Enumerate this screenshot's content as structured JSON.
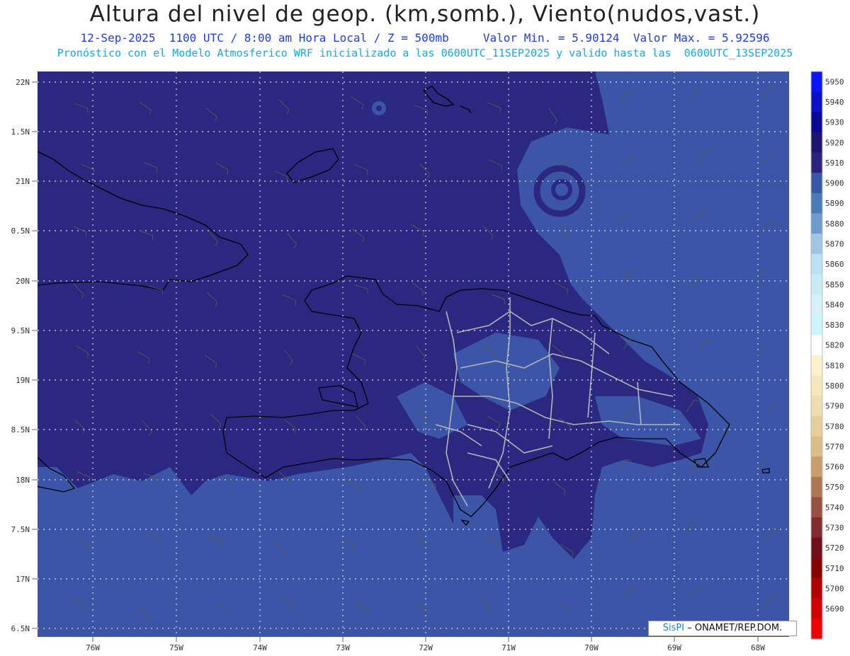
{
  "header": {
    "title": "Altura del nivel de geop. (km,somb.), Viento(nudos,vast.)",
    "line1_date": "12-Sep-2025",
    "line1_time": "1100 UTC / 8:00 am Hora Local / Z = 500mb",
    "line1_min": "Valor Min. = 5.90124",
    "line1_max": "Valor Max. = 5.92596",
    "line2": "Pronóstico con el Modelo Atmosferico WRF inicializado a las 0600UTC_11SEP2025 y valido hasta las  0600UTC_13SEP2025"
  },
  "axes": {
    "lat_labels": [
      "22N",
      "1.5N",
      "21N",
      "0.5N",
      "20N",
      "9.5N",
      "19N",
      "8.5N",
      "18N",
      "7.5N",
      "17N",
      "6.5N"
    ],
    "lon_labels": [
      "76W",
      "75W",
      "74W",
      "73W",
      "72W",
      "71W",
      "70W",
      "69W",
      "68W"
    ]
  },
  "colorbar": {
    "levels": [
      "5950",
      "5940",
      "5930",
      "5920",
      "5910",
      "5900",
      "5890",
      "5880",
      "5870",
      "5860",
      "5850",
      "5840",
      "5830",
      "5820",
      "5810",
      "5800",
      "5790",
      "5780",
      "5770",
      "5760",
      "5750",
      "5740",
      "5730",
      "5720",
      "5710",
      "5700",
      "5690"
    ],
    "colors": [
      "#0a14ff",
      "#0a0fc8",
      "#0a0a96",
      "#1c1670",
      "#2a2480",
      "#3a58a8",
      "#4a7ab8",
      "#6f9cd0",
      "#9fc5e6",
      "#b8e2f2",
      "#c8ecf6",
      "#d6f1fa",
      "#cbf5fb",
      "#ffffff",
      "#fbf2cc",
      "#f5e8bc",
      "#efdeb0",
      "#e6cf9c",
      "#dcbd84",
      "#c99e6a",
      "#b07852",
      "#9a5040",
      "#832a30",
      "#720e1c",
      "#8a0000",
      "#b20000",
      "#d40000",
      "#f00000"
    ]
  },
  "map": {
    "field_colors": {
      "level_5910": "#2b2880",
      "level_5900": "#3b56a6",
      "level_5920": "#1d1a6a"
    },
    "coastline_color": "#000000",
    "province_border_color": "#b0b0b0"
  },
  "credit": {
    "brand": "SisPI",
    "text": "– ONAMET/REP.DOM."
  }
}
